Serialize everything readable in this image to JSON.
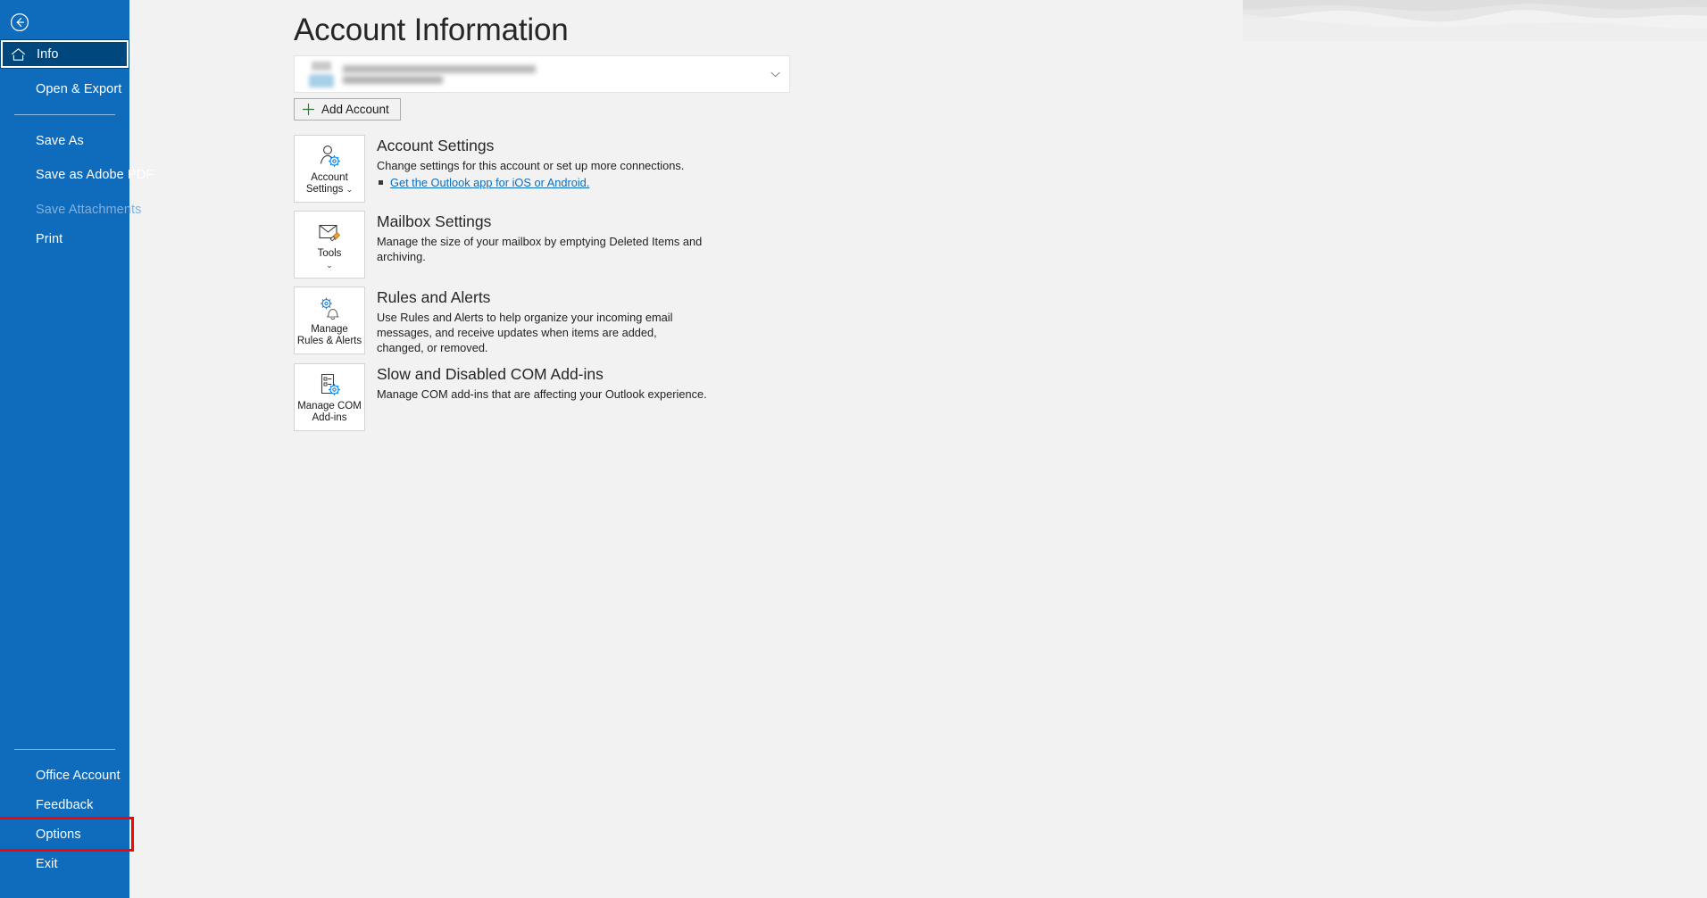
{
  "window": {
    "page_title": "Account Information",
    "accent_color": "#0f6cbd",
    "selected_color": "#00477d",
    "annotation_color": "#ff0000",
    "link_color": "#0f6cbd"
  },
  "rail": {
    "back_label": "Back",
    "back_icon": "circle-back-arrow-icon",
    "top_items": [
      {
        "label": "Info",
        "icon": "home-icon",
        "state": "selected"
      },
      {
        "label": "Open & Export",
        "state": "normal"
      }
    ],
    "middle_items": [
      {
        "label": "Save As",
        "state": "normal"
      },
      {
        "label": "Save as Adobe PDF",
        "state": "normal",
        "multiline": true
      },
      {
        "label": "Save Attachments",
        "state": "disabled"
      },
      {
        "label": "Print",
        "state": "normal"
      }
    ],
    "bottom_items": [
      {
        "label": "Office Account",
        "state": "normal"
      },
      {
        "label": "Feedback",
        "state": "normal"
      },
      {
        "label": "Options",
        "state": "annotated"
      },
      {
        "label": "Exit",
        "state": "normal"
      }
    ]
  },
  "account": {
    "email_redacted": "",
    "name_redacted": "",
    "avatar_icon": "person-avatar-icon",
    "dropdown_icon": "chevron-down-icon",
    "add_account_label": "Add Account",
    "add_account_icon": "plus-icon"
  },
  "sections": [
    {
      "button_label": "Account Settings",
      "button_has_caret": true,
      "button_icon": "person-gear-icon",
      "title": "Account Settings",
      "desc": "Change settings for this account or set up more connections.",
      "link": "Get the Outlook app for iOS or Android.",
      "bullet_icon": "square-bullet-icon"
    },
    {
      "button_label": "Tools",
      "button_has_caret": true,
      "button_icon": "mailbox-cleanup-icon",
      "title": "Mailbox Settings",
      "desc": "Manage the size of your mailbox by emptying Deleted Items and archiving.",
      "link": "",
      "bullet_icon": ""
    },
    {
      "button_label": "Manage Rules & Alerts",
      "button_has_caret": false,
      "button_icon": "gear-bell-icon",
      "title": "Rules and Alerts",
      "desc": "Use Rules and Alerts to help organize your incoming email messages, and receive updates when items are added, changed, or removed.",
      "link": "",
      "bullet_icon": ""
    },
    {
      "button_label": "Manage COM Add-ins",
      "button_has_caret": false,
      "button_icon": "com-addins-icon",
      "title": "Slow and Disabled COM Add-ins",
      "desc": "Manage COM add-ins that are affecting your Outlook experience.",
      "link": "",
      "bullet_icon": ""
    }
  ]
}
